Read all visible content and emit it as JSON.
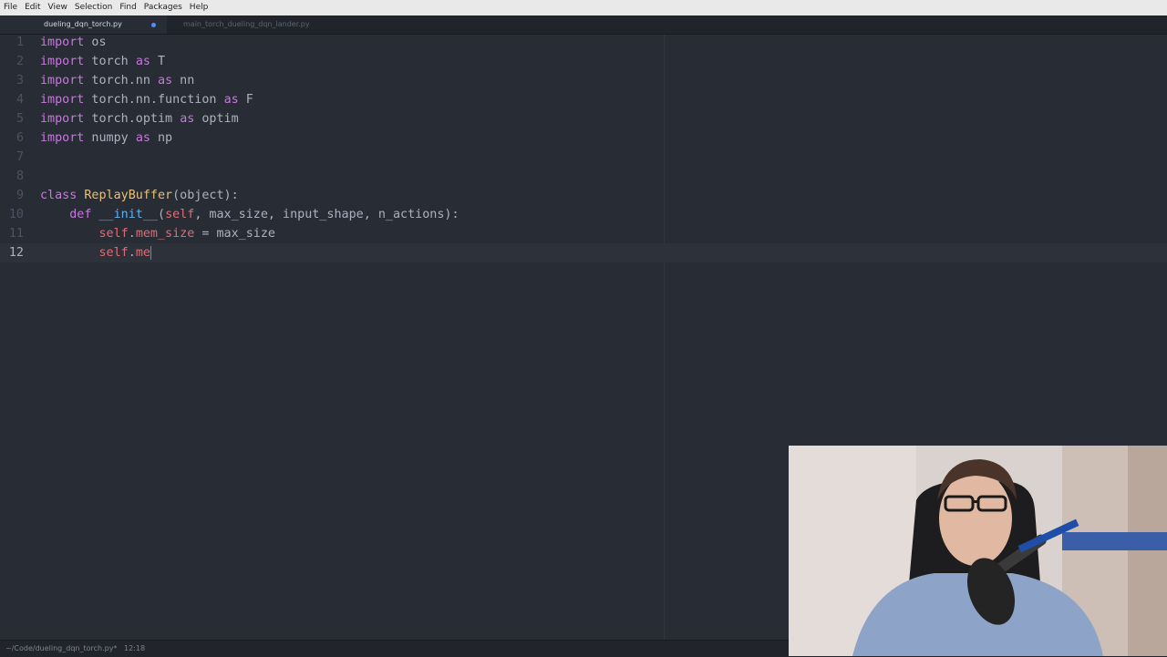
{
  "menubar": {
    "items": [
      "File",
      "Edit",
      "View",
      "Selection",
      "Find",
      "Packages",
      "Help"
    ]
  },
  "tabs": [
    {
      "label": "dueling_dqn_torch.py",
      "active": true,
      "modified": true
    },
    {
      "label": "main_torch_dueling_dqn_lander.py",
      "active": false,
      "modified": false
    }
  ],
  "editor": {
    "cursor_line": 12,
    "lines": [
      {
        "num": "1",
        "tokens": [
          {
            "t": "import",
            "c": "kw"
          },
          {
            "t": " os",
            "c": ""
          }
        ]
      },
      {
        "num": "2",
        "tokens": [
          {
            "t": "import",
            "c": "kw"
          },
          {
            "t": " torch ",
            "c": ""
          },
          {
            "t": "as",
            "c": "kw"
          },
          {
            "t": " T",
            "c": ""
          }
        ]
      },
      {
        "num": "3",
        "tokens": [
          {
            "t": "import",
            "c": "kw"
          },
          {
            "t": " torch.nn ",
            "c": ""
          },
          {
            "t": "as",
            "c": "kw"
          },
          {
            "t": " nn",
            "c": ""
          }
        ]
      },
      {
        "num": "4",
        "tokens": [
          {
            "t": "import",
            "c": "kw"
          },
          {
            "t": " torch.nn.function ",
            "c": ""
          },
          {
            "t": "as",
            "c": "kw"
          },
          {
            "t": " F",
            "c": ""
          }
        ]
      },
      {
        "num": "5",
        "tokens": [
          {
            "t": "import",
            "c": "kw"
          },
          {
            "t": " torch.optim ",
            "c": ""
          },
          {
            "t": "as",
            "c": "kw"
          },
          {
            "t": " optim",
            "c": ""
          }
        ]
      },
      {
        "num": "6",
        "tokens": [
          {
            "t": "import",
            "c": "kw"
          },
          {
            "t": " numpy ",
            "c": ""
          },
          {
            "t": "as",
            "c": "kw"
          },
          {
            "t": " np",
            "c": ""
          }
        ]
      },
      {
        "num": "7",
        "tokens": []
      },
      {
        "num": "8",
        "tokens": []
      },
      {
        "num": "9",
        "tokens": [
          {
            "t": "class",
            "c": "kw"
          },
          {
            "t": " ",
            "c": ""
          },
          {
            "t": "ReplayBuffer",
            "c": "cls"
          },
          {
            "t": "(object):",
            "c": ""
          }
        ]
      },
      {
        "num": "10",
        "tokens": [
          {
            "t": "    ",
            "c": ""
          },
          {
            "t": "def",
            "c": "kw"
          },
          {
            "t": " ",
            "c": ""
          },
          {
            "t": "__init__",
            "c": "fn"
          },
          {
            "t": "(",
            "c": ""
          },
          {
            "t": "self",
            "c": "prm"
          },
          {
            "t": ", max_size, input_shape, n_actions):",
            "c": ""
          }
        ]
      },
      {
        "num": "11",
        "tokens": [
          {
            "t": "        ",
            "c": ""
          },
          {
            "t": "self",
            "c": "prm"
          },
          {
            "t": ".",
            "c": ""
          },
          {
            "t": "mem_size",
            "c": "prm"
          },
          {
            "t": " = max_size",
            "c": ""
          }
        ]
      },
      {
        "num": "12",
        "tokens": [
          {
            "t": "        ",
            "c": ""
          },
          {
            "t": "self",
            "c": "prm"
          },
          {
            "t": ".",
            "c": ""
          },
          {
            "t": "me",
            "c": "prm"
          }
        ]
      }
    ]
  },
  "statusbar": {
    "path": "~/Code/dueling_dqn_torch.py*",
    "position": "12:18"
  },
  "webcam": {
    "description": "presenter webcam overlay"
  },
  "colors": {
    "background": "#282c34",
    "keyword": "#c678dd",
    "function": "#61afef",
    "class": "#e5c07b",
    "self": "#e06c75"
  }
}
